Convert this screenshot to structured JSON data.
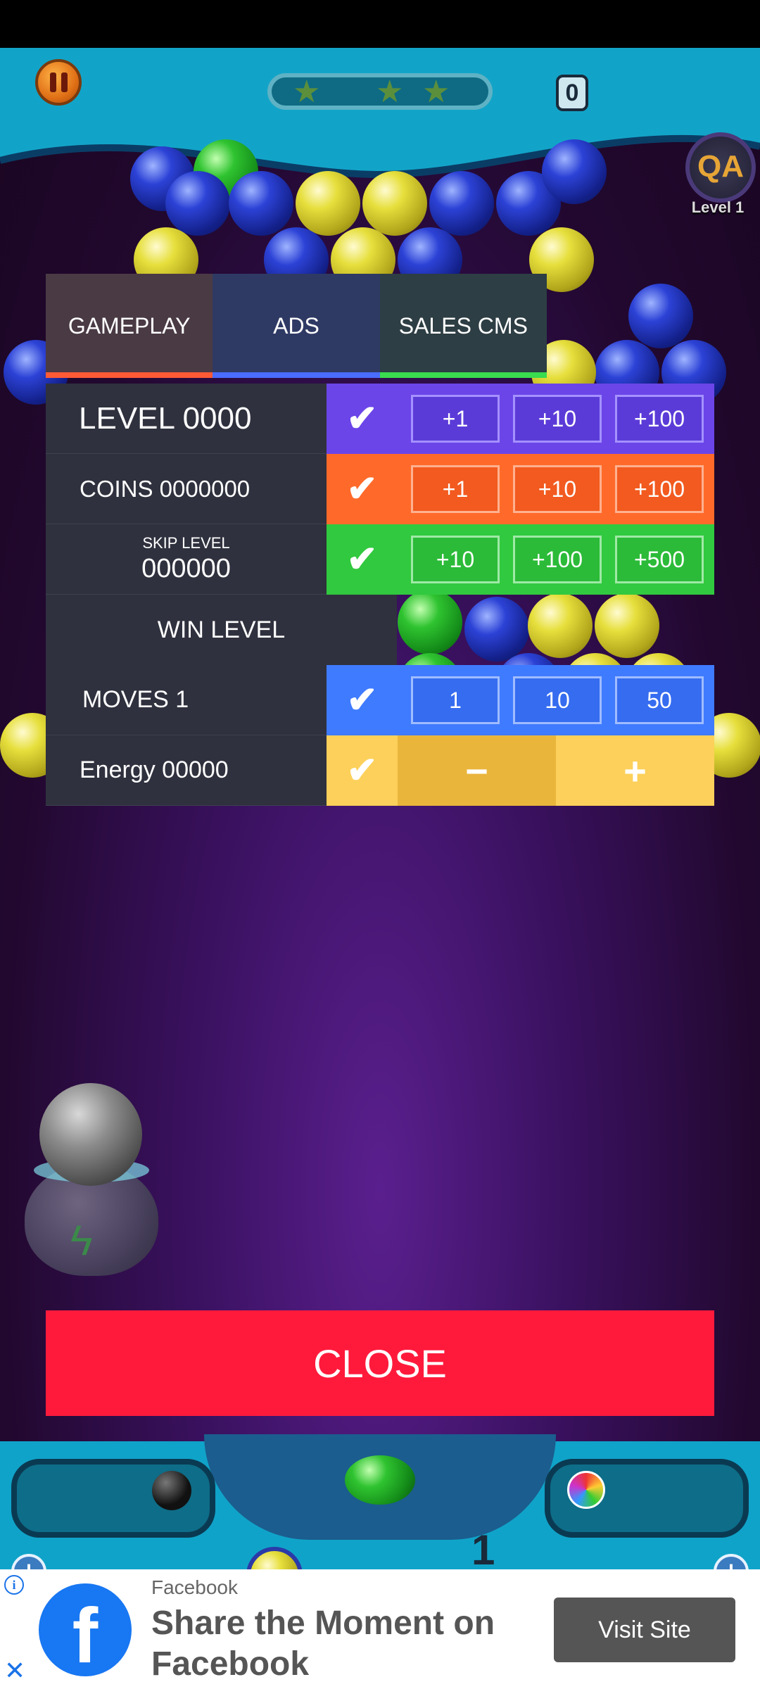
{
  "hud": {
    "score": "0",
    "qa_badge": "QA",
    "qa_level": "Level 1"
  },
  "debug_panel": {
    "tabs": [
      {
        "label": "GAMEPLAY",
        "accent": "#ff5a36"
      },
      {
        "label": "ADS",
        "accent": "#4a6cff"
      },
      {
        "label": "SALES CMS",
        "accent": "#3adb4f"
      }
    ],
    "level": {
      "label": "LEVEL  0000",
      "increments": [
        "+1",
        "+10",
        "+100"
      ],
      "color": "#6b45e8"
    },
    "coins": {
      "label": "COINS  0000000",
      "increments": [
        "+1",
        "+10",
        "+100"
      ],
      "color": "#ff6a2a"
    },
    "skip_level": {
      "caption": "SKIP LEVEL",
      "value": "000000",
      "increments": [
        "+10",
        "+100",
        "+500"
      ],
      "color": "#31c93f"
    },
    "win_level": {
      "label": "WIN LEVEL"
    },
    "moves": {
      "label": "MOVES  1",
      "options": [
        "1",
        "10",
        "50"
      ],
      "color": "#3f7bff"
    },
    "energy": {
      "label": "Energy 00000",
      "minus": "−",
      "plus": "+",
      "color": "#fcd05a"
    }
  },
  "close_button": {
    "label": "CLOSE",
    "color": "#ff1a3c"
  },
  "bottom": {
    "moves_count": "1"
  },
  "ad": {
    "source": "Facebook",
    "headline": "Share the Moment on Facebook",
    "cta": "Visit Site",
    "logo_letter": "f"
  }
}
